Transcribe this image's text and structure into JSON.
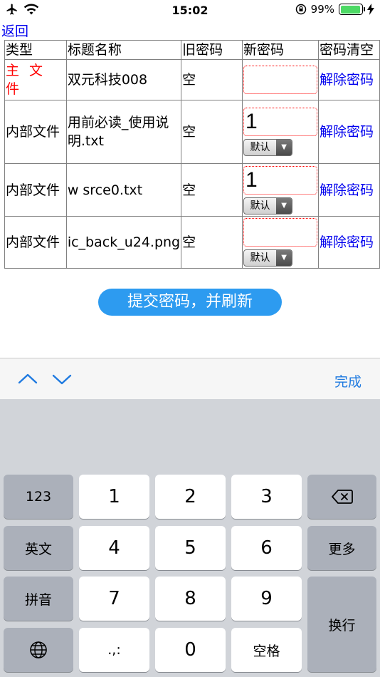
{
  "status_bar": {
    "time": "15:02",
    "battery": "99%"
  },
  "nav": {
    "back_label": "返回"
  },
  "table": {
    "headers": [
      "类型",
      "标题名称",
      "旧密码",
      "新密码",
      "密码清空"
    ],
    "rows": [
      {
        "type": "主 文 件",
        "title": "双元科技008",
        "old": "空",
        "new_value": "",
        "clear": "解除密码",
        "has_select": false
      },
      {
        "type": "内部文件",
        "title": "用前必读_使用说明.txt",
        "old": "空",
        "new_value": "1",
        "clear": "解除密码",
        "has_select": true,
        "select": "默认"
      },
      {
        "type": "内部文件",
        "title": "w srce0.txt",
        "old": "空",
        "new_value": "1",
        "clear": "解除密码",
        "has_select": true,
        "select": "默认"
      },
      {
        "type": "内部文件",
        "title": "ic_back_u24.png",
        "old": "空",
        "new_value": "",
        "clear": "解除密码",
        "has_select": true,
        "select": "默认"
      }
    ]
  },
  "submit_label": "提交密码，并刷新",
  "keyboard_toolbar": {
    "done_label": "完成",
    "up_icon": "chevron-up-icon",
    "down_icon": "chevron-down-icon"
  },
  "keyboard": {
    "keys": {
      "k123": "123",
      "k1": "1",
      "k2": "2",
      "k3": "3",
      "kEn": "英文",
      "k4": "4",
      "k5": "5",
      "k6": "6",
      "kMore": "更多",
      "kPinyin": "拼音",
      "k7": "7",
      "k8": "8",
      "k9": "9",
      "kEnter": "换行",
      "kPunct": ".,:",
      "k0": "0",
      "kSpace": "空格"
    },
    "globe_icon": "globe-icon",
    "delete_icon": "backspace-icon"
  }
}
